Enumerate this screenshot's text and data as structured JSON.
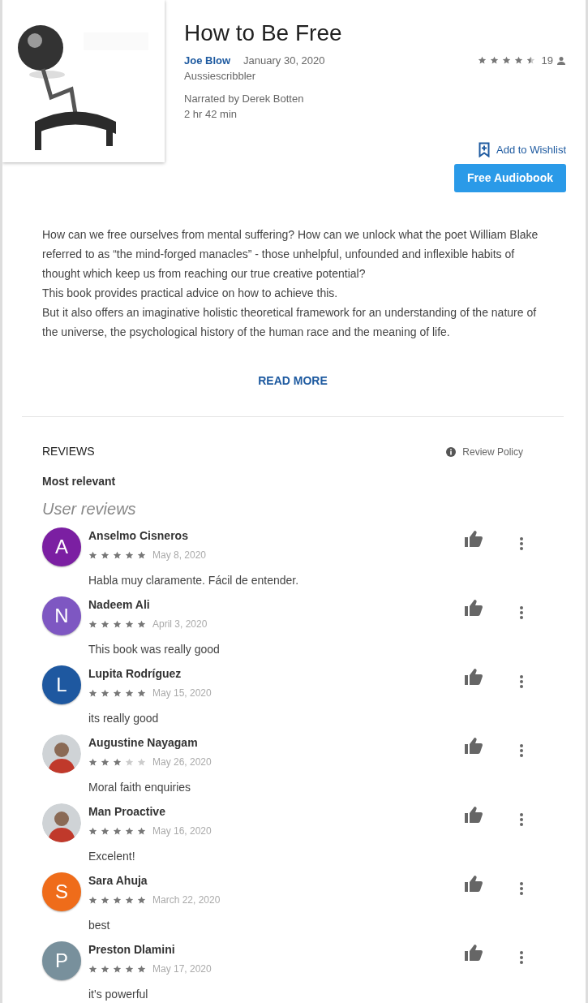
{
  "book": {
    "title": "How to Be Free",
    "author": "Joe Blow",
    "date": "January 30, 2020",
    "publisher": "Aussiescribbler",
    "narrator": "Narrated by Derek Botten",
    "duration": "2 hr 42 min",
    "rating": {
      "stars": 4.5,
      "count": "19"
    },
    "wishlist": "Add to Wishlist",
    "buy": "Free Audiobook"
  },
  "description": {
    "lines": [
      "How can we free ourselves from mental suffering? How can we unlock what the poet William Blake referred to as “the mind-forged manacles” - those unhelpful, unfounded and inflexible habits of thought which keep us from reaching our true creative potential?",
      "This book provides practical advice on how to achieve this.",
      "But it also offers an imaginative holistic theoretical framework for an understanding of the nature of the universe, the psychological history of the human race and the meaning of life."
    ],
    "read_more": "READ MORE"
  },
  "reviews": {
    "heading": "REVIEWS",
    "policy": "Review Policy",
    "sort": "Most relevant",
    "subheading": "User reviews",
    "items": [
      {
        "name": "Anselmo Cisneros",
        "avatar": {
          "kind": "letter",
          "letter": "A",
          "color": "#7b1fa2"
        },
        "stars": 5,
        "date": "May 8, 2020",
        "text": "Habla muy claramente. Fácil de entender."
      },
      {
        "name": "Nadeem Ali",
        "avatar": {
          "kind": "letter",
          "letter": "N",
          "color": "#7e57c2"
        },
        "stars": 5,
        "date": "April 3, 2020",
        "text": "This book was really good"
      },
      {
        "name": "Lupita Rodríguez",
        "avatar": {
          "kind": "letter",
          "letter": "L",
          "color": "#1e58a0"
        },
        "stars": 5,
        "date": "May 15, 2020",
        "text": "its really good"
      },
      {
        "name": "Augustine Nayagam",
        "stars": 3,
        "date": "May 26, 2020",
        "text": "Moral faith enquiries"
      },
      {
        "name": "Man Proactive",
        "stars": 5,
        "date": "May 16, 2020",
        "text": "Excelent!"
      },
      {
        "name": "Sara Ahuja",
        "avatar": {
          "kind": "letter",
          "letter": "S",
          "color": "#ef6c1a"
        },
        "stars": 5,
        "date": "March 22, 2020",
        "text": "best"
      },
      {
        "name": "Preston Dlamini",
        "avatar": {
          "kind": "letter",
          "letter": "P",
          "color": "#78909c"
        },
        "stars": 5,
        "date": "May 17, 2020",
        "text": "it's powerful"
      }
    ]
  }
}
